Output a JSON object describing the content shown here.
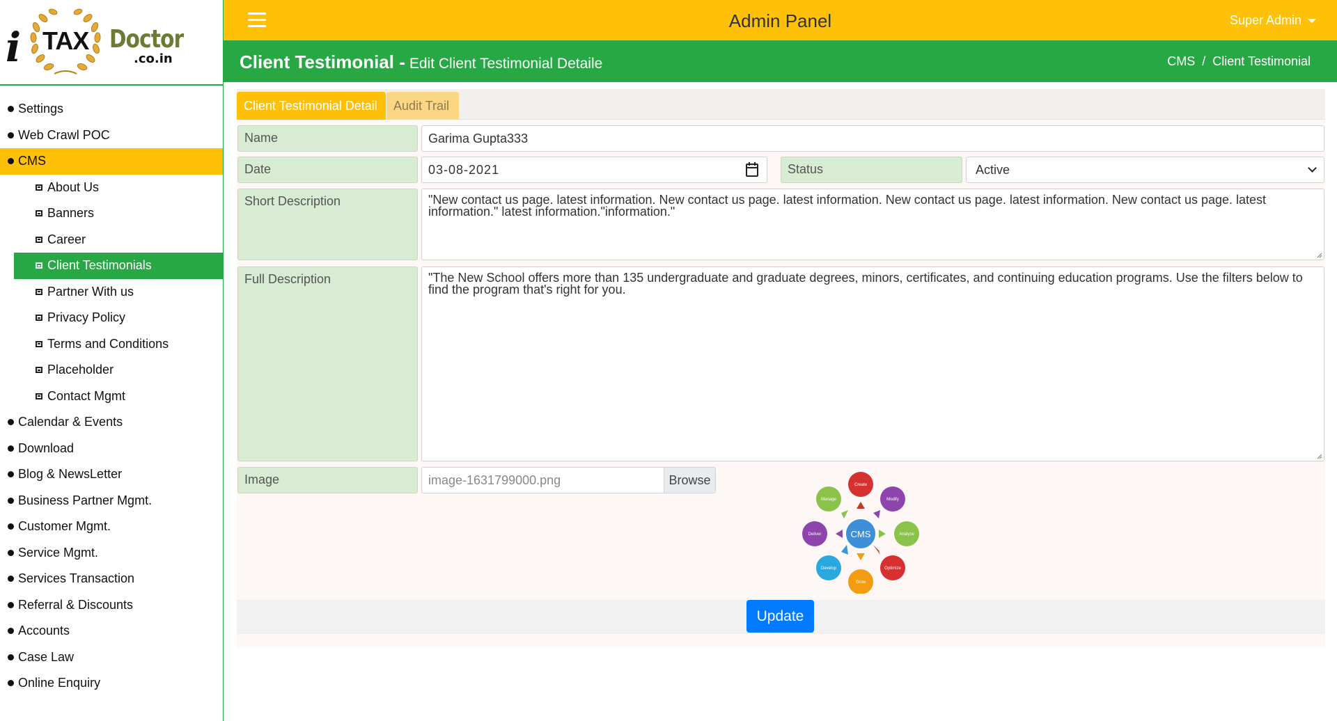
{
  "brand": {
    "logo_i": "i",
    "logo_tax": "TAX",
    "logo_doctor": "Doctor",
    "logo_domain": ".co.in"
  },
  "topbar": {
    "title": "Admin Panel",
    "user": "Super Admin"
  },
  "page": {
    "title": "Client Testimonial -",
    "subtitle": "Edit Client Testimonial Detaile",
    "breadcrumb": [
      "CMS",
      "/",
      "Client Testimonial"
    ]
  },
  "sidebar": {
    "items": [
      {
        "label": "Settings"
      },
      {
        "label": "Web Crawl POC"
      },
      {
        "label": "CMS",
        "active": true
      },
      {
        "label": "About Us"
      },
      {
        "label": "Banners"
      },
      {
        "label": "Career"
      },
      {
        "label": "Client Testimonials",
        "active": true
      },
      {
        "label": "Partner With us"
      },
      {
        "label": "Privacy Policy"
      },
      {
        "label": "Terms and Conditions"
      },
      {
        "label": "Placeholder"
      },
      {
        "label": "Contact Mgmt"
      },
      {
        "label": "Calendar & Events"
      },
      {
        "label": "Download"
      },
      {
        "label": "Blog & NewsLetter"
      },
      {
        "label": "Business Partner Mgmt."
      },
      {
        "label": "Customer Mgmt."
      },
      {
        "label": "Service Mgmt."
      },
      {
        "label": "Services Transaction"
      },
      {
        "label": "Referral & Discounts"
      },
      {
        "label": "Accounts"
      },
      {
        "label": "Case Law"
      },
      {
        "label": "Online Enquiry"
      }
    ]
  },
  "tabs": {
    "detail": "Client Testimonial Detail",
    "audit": "Audit Trail"
  },
  "form": {
    "name_label": "Name",
    "name_value": "Garima Gupta333",
    "date_label": "Date",
    "date_value": "03-08-2021",
    "status_label": "Status",
    "status_value": "Active",
    "short_label": "Short Description",
    "short_value": "\"New contact us page. latest information. New contact us page. latest information. New contact us page. latest information. New contact us page. latest information.\" latest information.\"information.\"",
    "full_label": "Full Description",
    "full_value": "\"The New School offers more than 135 undergraduate and graduate degrees, minors, certificates, and continuing education programs. Use the filters below to find the program that's right for you.",
    "image_label": "Image",
    "image_filename": "image-1631799000.png",
    "browse_label": "Browse",
    "update_label": "Update"
  },
  "cms_diagram": {
    "center": "CMS",
    "nodes": [
      "Create",
      "Modify",
      "Analyze",
      "Optimize",
      "Grow",
      "Develop",
      "Deliver",
      "Manage"
    ]
  },
  "colors": {
    "topbar": "#ffc107",
    "header": "#28a745",
    "label_bg": "#d7ecd2",
    "primary_button": "#007bff"
  }
}
